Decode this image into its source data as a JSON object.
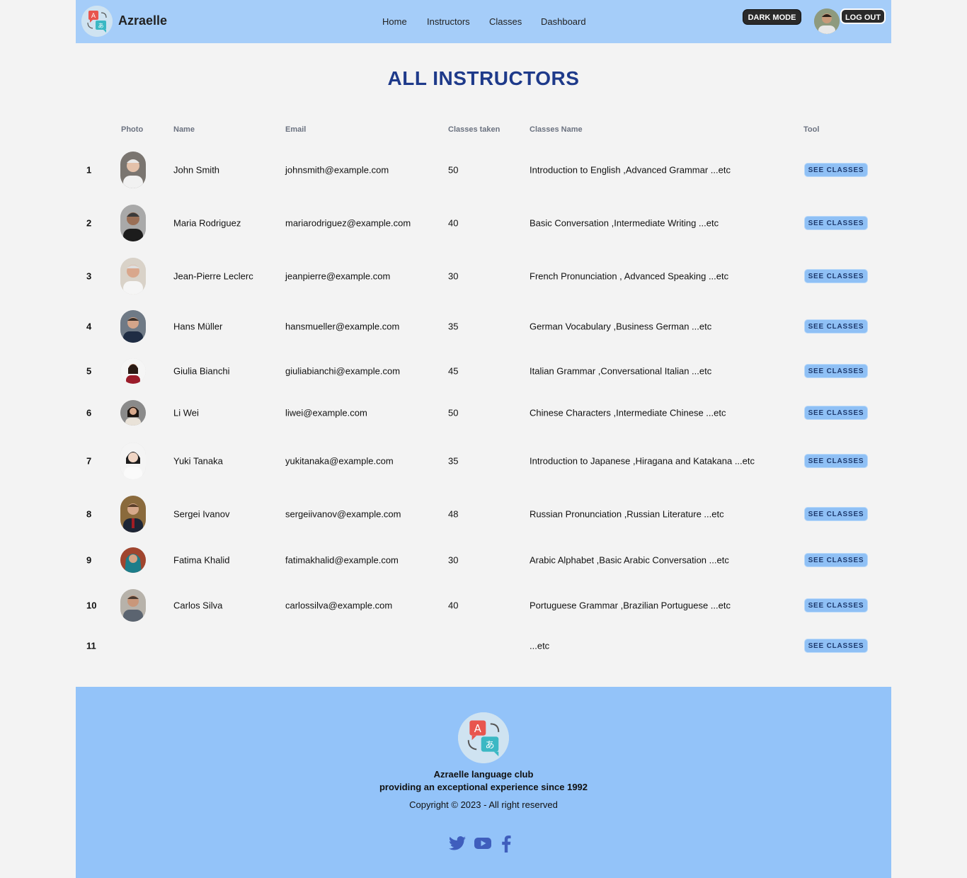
{
  "brand": {
    "name": "Azraelle"
  },
  "nav": {
    "home": "Home",
    "instructors": "Instructors",
    "classes": "Classes",
    "dashboard": "Dashboard"
  },
  "header": {
    "dark_mode": "DARK MODE",
    "log_out": "LOG OUT"
  },
  "page_title": "ALL INSTRUCTORS",
  "table": {
    "columns": {
      "photo": "Photo",
      "name": "Name",
      "email": "Email",
      "classes_taken": "Classes taken",
      "classes_name": "Classes Name",
      "tool": "Tool"
    },
    "rows": [
      {
        "num": "1",
        "name": "John Smith",
        "email": "johnsmith@example.com",
        "count": "50",
        "classes": "Introduction to English ,Advanced Grammar ...etc",
        "tool": "SEE CLASSES"
      },
      {
        "num": "2",
        "name": "Maria Rodriguez",
        "email": "mariarodriguez@example.com",
        "count": "40",
        "classes": "Basic Conversation ,Intermediate Writing ...etc",
        "tool": "SEE CLASSES"
      },
      {
        "num": "3",
        "name": "Jean-Pierre Leclerc",
        "email": "jeanpierre@example.com",
        "count": "30",
        "classes": "French Pronunciation , Advanced Speaking ...etc",
        "tool": "SEE CLASSES"
      },
      {
        "num": "4",
        "name": "Hans Müller",
        "email": "hansmueller@example.com",
        "count": "35",
        "classes": "German Vocabulary ,Business German ...etc",
        "tool": "SEE CLASSES"
      },
      {
        "num": "5",
        "name": "Giulia Bianchi",
        "email": "giuliabianchi@example.com",
        "count": "45",
        "classes": "Italian Grammar ,Conversational Italian ...etc",
        "tool": "SEE CLASSES"
      },
      {
        "num": "6",
        "name": "Li Wei",
        "email": "liwei@example.com",
        "count": "50",
        "classes": "Chinese Characters ,Intermediate Chinese ...etc",
        "tool": "SEE CLASSES"
      },
      {
        "num": "7",
        "name": "Yuki Tanaka",
        "email": "yukitanaka@example.com",
        "count": "35",
        "classes": "Introduction to Japanese ,Hiragana and Katakana ...etc",
        "tool": "SEE CLASSES"
      },
      {
        "num": "8",
        "name": "Sergei Ivanov",
        "email": "sergeiivanov@example.com",
        "count": "48",
        "classes": "Russian Pronunciation ,Russian Literature ...etc",
        "tool": "SEE CLASSES"
      },
      {
        "num": "9",
        "name": "Fatima Khalid",
        "email": "fatimakhalid@example.com",
        "count": "30",
        "classes": "Arabic Alphabet ,Basic Arabic Conversation ...etc",
        "tool": "SEE CLASSES"
      },
      {
        "num": "10",
        "name": "Carlos Silva",
        "email": "carlossilva@example.com",
        "count": "40",
        "classes": "Portuguese Grammar ,Brazilian Portuguese ...etc",
        "tool": "SEE CLASSES"
      },
      {
        "num": "11",
        "name": "",
        "email": "",
        "count": "",
        "classes": "...etc",
        "tool": "SEE CLASSES"
      }
    ]
  },
  "footer": {
    "name": "Azraelle language club",
    "tagline": "providing an exceptional experience since 1992",
    "copyright": "Copyright © 2023 - All right reserved"
  },
  "colors": {
    "navbar": "#a5cdf9",
    "footer": "#93c3f9",
    "title": "#1e3a8a",
    "button": "#8fc0f5"
  }
}
